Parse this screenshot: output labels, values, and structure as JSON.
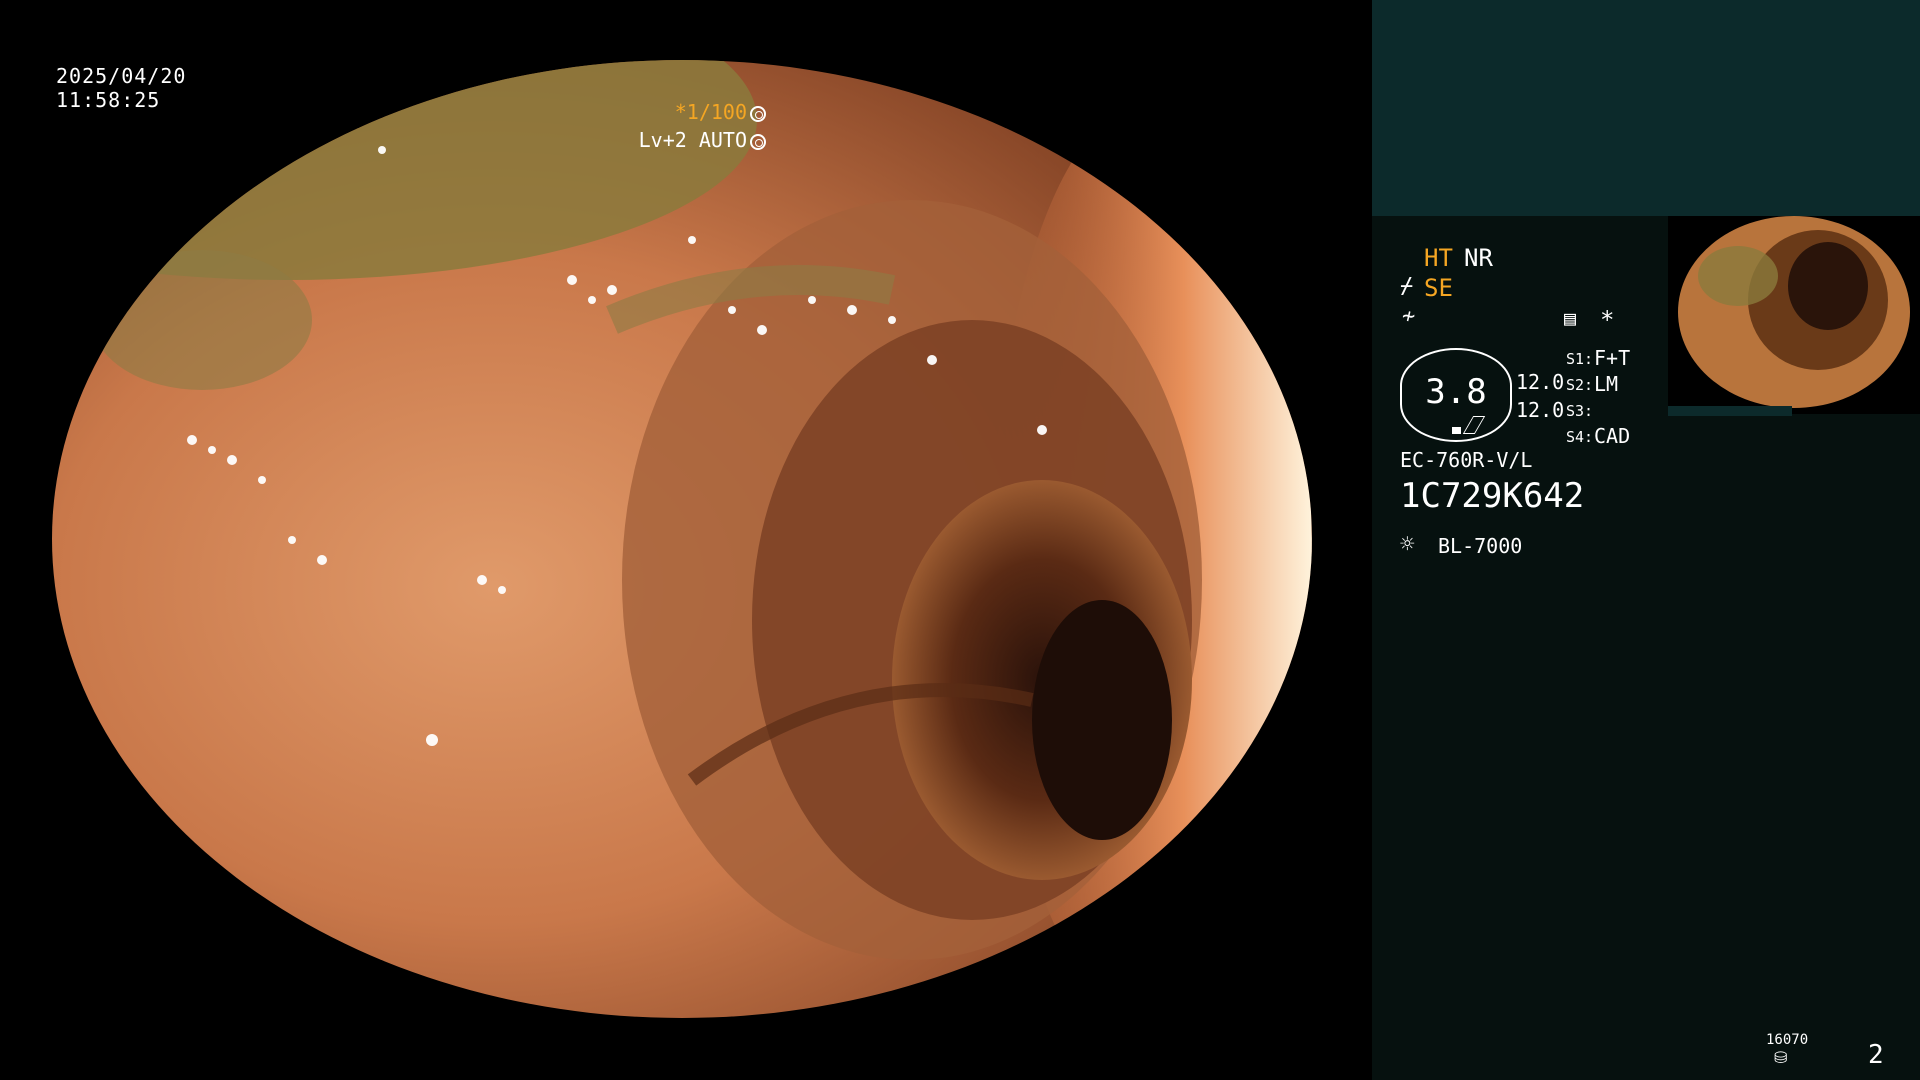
{
  "overlay": {
    "date": "2025/04/20",
    "time": "11:58:25",
    "shutter": "*1/100",
    "level": "Lv+2",
    "mode": "AUTO"
  },
  "panel": {
    "ht": "HT",
    "nr": "NR",
    "se": "SE",
    "zoom_value": "3.8",
    "param_1": "12.0",
    "param_2": "12.0",
    "s1_label": "S1:",
    "s1_value": "F+T",
    "s2_label": "S2:",
    "s2_value": "LM",
    "s3_label": "S3:",
    "s3_value": "",
    "s4_label": "S4:",
    "s4_value": "CAD",
    "scope_model": "EC-760R-V/L",
    "serial": "1C729K642",
    "light_source": "BL-7000",
    "disk_count": "16070",
    "page_number": "2",
    "asterisk": "*"
  },
  "colors": {
    "accent_orange": "#f5a623",
    "panel_bg": "#06110f",
    "panel_top": "#0c2a2b"
  },
  "icons": [
    "fiber-icon",
    "freeze-icon",
    "settings-list-icon",
    "light-bulb-icon",
    "disk-icon",
    "shutter-iris-icon",
    "auto-iris-icon"
  ]
}
